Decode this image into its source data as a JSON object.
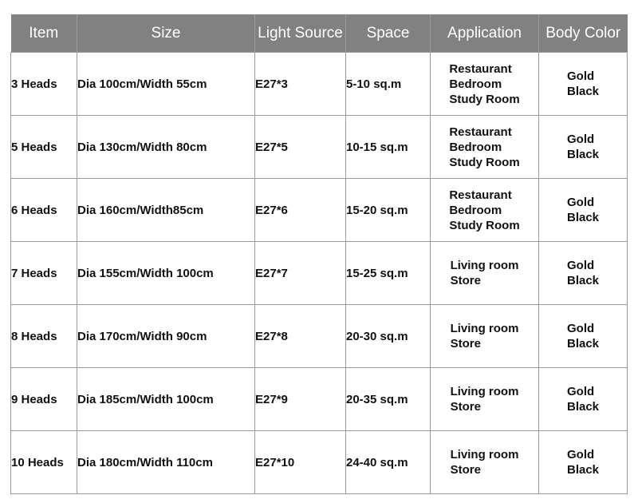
{
  "table": {
    "headers": [
      "Item",
      "Size",
      "Light Source",
      "Space",
      "Application",
      "Body Color"
    ],
    "rows": [
      {
        "item": "3 Heads",
        "size": "Dia 100cm/Width 55cm",
        "light": "E27*3",
        "space": "5-10 sq.m",
        "application": [
          "Restaurant",
          "Bedroom",
          "Study Room"
        ],
        "color": [
          "Gold",
          "Black"
        ]
      },
      {
        "item": "5 Heads",
        "size": "Dia 130cm/Width 80cm",
        "light": "E27*5",
        "space": "10-15 sq.m",
        "application": [
          "Restaurant",
          "Bedroom",
          "Study Room"
        ],
        "color": [
          "Gold",
          "Black"
        ]
      },
      {
        "item": "6 Heads",
        "size": "Dia 160cm/Width85cm",
        "light": "E27*6",
        "space": "15-20 sq.m",
        "application": [
          "Restaurant",
          "Bedroom",
          "Study Room"
        ],
        "color": [
          "Gold",
          "Black"
        ]
      },
      {
        "item": "7 Heads",
        "size": "Dia 155cm/Width 100cm",
        "light": "E27*7",
        "space": "15-25 sq.m",
        "application": [
          "Living room",
          "Store"
        ],
        "color": [
          "Gold",
          "Black"
        ]
      },
      {
        "item": "8 Heads",
        "size": "Dia 170cm/Width 90cm",
        "light": "E27*8",
        "space": "20-30 sq.m",
        "application": [
          "Living room",
          "Store"
        ],
        "color": [
          "Gold",
          "Black"
        ]
      },
      {
        "item": "9 Heads",
        "size": "Dia 185cm/Width 100cm",
        "light": "E27*9",
        "space": "20-35 sq.m",
        "application": [
          "Living room",
          "Store"
        ],
        "color": [
          "Gold",
          "Black"
        ]
      },
      {
        "item": "10 Heads",
        "size": "Dia 180cm/Width 110cm",
        "light": "E27*10",
        "space": "24-40 sq.m",
        "application": [
          "Living room",
          "Store"
        ],
        "color": [
          "Gold",
          "Black"
        ]
      }
    ]
  },
  "colors": {
    "header_bg": "#818181",
    "header_text": "#ffffff",
    "border": "#9a9a9a",
    "text": "#111111"
  }
}
